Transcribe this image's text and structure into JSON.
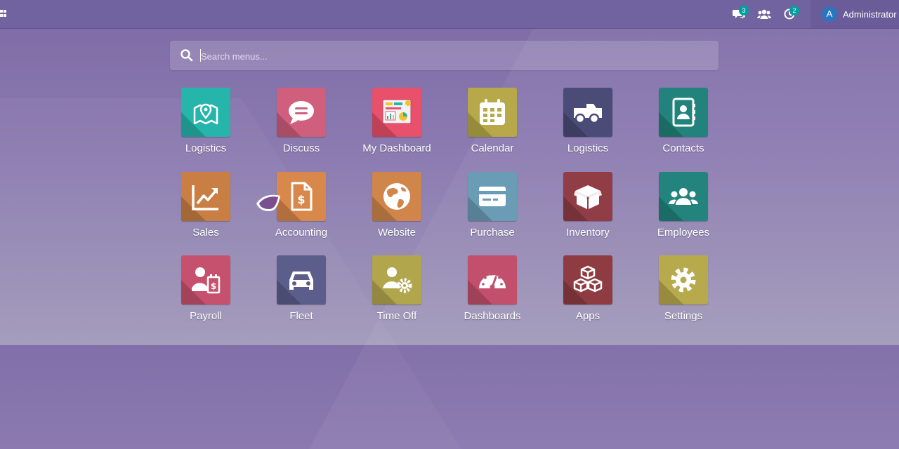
{
  "topbar": {
    "messages_badge": "3",
    "activity_badge": "2",
    "user_initial": "A",
    "user_name": "Administrator"
  },
  "search": {
    "placeholder": "Search menus..."
  },
  "apps": [
    {
      "label": "Logistics",
      "icon": "map-marker-icon",
      "color": "#26b5ab"
    },
    {
      "label": "Discuss",
      "icon": "chat-bubble-icon",
      "color": "#cf5f7d"
    },
    {
      "label": "My Dashboard",
      "icon": "dashboard-board-icon",
      "color": "#e8506c"
    },
    {
      "label": "Calendar",
      "icon": "calendar-icon",
      "color": "#b7a949"
    },
    {
      "label": "Logistics",
      "icon": "truck-icon",
      "color": "#4a4b77"
    },
    {
      "label": "Contacts",
      "icon": "address-book-icon",
      "color": "#21837c"
    },
    {
      "label": "Sales",
      "icon": "chart-trend-icon",
      "color": "#c97f43"
    },
    {
      "label": "Accounting",
      "icon": "invoice-dollar-icon",
      "color": "#d9884b"
    },
    {
      "label": "Website",
      "icon": "globe-icon",
      "color": "#d0864a"
    },
    {
      "label": "Purchase",
      "icon": "credit-card-icon",
      "color": "#6b9cb6"
    },
    {
      "label": "Inventory",
      "icon": "box-icon",
      "color": "#913d46"
    },
    {
      "label": "Employees",
      "icon": "users-icon",
      "color": "#22847d"
    },
    {
      "label": "Payroll",
      "icon": "payroll-user-dollar-icon",
      "color": "#c6516f"
    },
    {
      "label": "Fleet",
      "icon": "car-icon",
      "color": "#5b5e8a"
    },
    {
      "label": "Time Off",
      "icon": "user-gear-icon",
      "color": "#b2a64d"
    },
    {
      "label": "Dashboards",
      "icon": "speedometer-icon",
      "color": "#c2506d"
    },
    {
      "label": "Apps",
      "icon": "cubes-icon",
      "color": "#8e3c42"
    },
    {
      "label": "Settings",
      "icon": "gear-icon",
      "color": "#b7aa4c"
    }
  ]
}
